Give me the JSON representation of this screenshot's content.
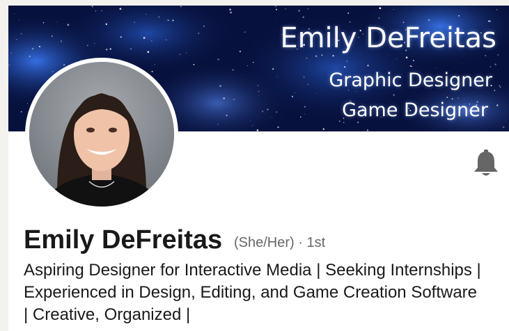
{
  "banner": {
    "name": "Emily DeFreitas",
    "line1": "Graphic Designer",
    "line2": "Game Designer",
    "background_color": "#06103a",
    "nebula_color": "#2f6fe0"
  },
  "profile": {
    "name": "Emily DeFreitas",
    "pronouns": "(She/Her)",
    "connection_separator": "·",
    "connection_degree": "1st",
    "headline": "Aspiring Designer for Interactive Media | Seeking Internships | Experienced in Design, Editing, and Game Creation Software | Creative, Organized |"
  },
  "icons": {
    "notification": "bell-icon"
  }
}
